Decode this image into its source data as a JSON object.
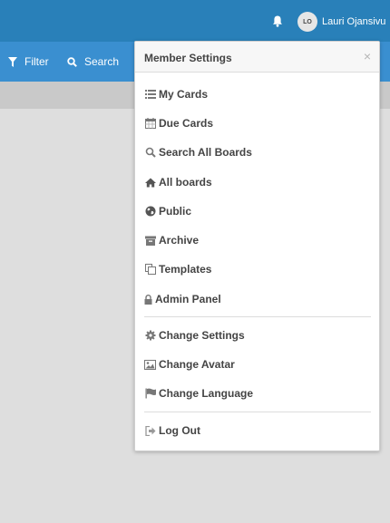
{
  "header": {
    "user_initials": "LO",
    "user_name": "Lauri Ojansivu"
  },
  "toolbar": {
    "filter_label": "Filter",
    "search_label": "Search"
  },
  "popup": {
    "title": "Member Settings",
    "close": "×",
    "items": [
      {
        "label": "My Cards",
        "icon": "list-icon"
      },
      {
        "label": "Due Cards",
        "icon": "calendar-icon"
      },
      {
        "label": "Search All Boards",
        "icon": "search-icon"
      },
      {
        "label": "All boards",
        "icon": "home-icon"
      },
      {
        "label": "Public",
        "icon": "globe-icon"
      },
      {
        "label": "Archive",
        "icon": "archive-icon"
      },
      {
        "label": "Templates",
        "icon": "copy-icon"
      },
      {
        "label": "Admin Panel",
        "icon": "lock-icon"
      },
      {
        "label": "Change Settings",
        "icon": "gear-icon"
      },
      {
        "label": "Change Avatar",
        "icon": "picture-icon"
      },
      {
        "label": "Change Language",
        "icon": "flag-icon"
      },
      {
        "label": "Log Out",
        "icon": "sign-out-icon"
      }
    ]
  },
  "colors": {
    "header_bg": "#2980b9",
    "subbar_bg": "#3a8fd0",
    "background": "#dedede",
    "text": "#444444"
  }
}
